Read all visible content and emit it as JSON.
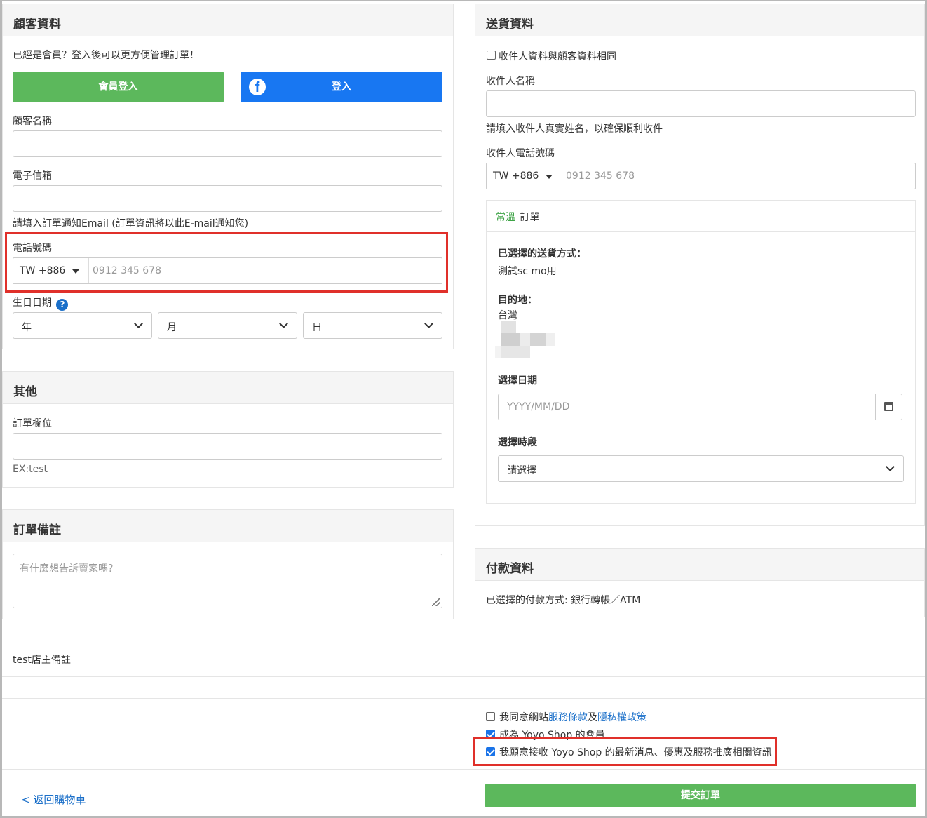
{
  "customer": {
    "title": "顧客資料",
    "member_prompt": "已經是會員？登入後可以更方便管理訂單！",
    "member_login_btn": "會員登入",
    "fb_login_btn": "登入",
    "name_label": "顧客名稱",
    "email_label": "電子信箱",
    "email_help": "請填入訂單通知Email (訂單資訊將以此E-mail通知您)",
    "phone_label": "電話號碼",
    "phone_cc": "TW  +886",
    "phone_placeholder": "0912 345 678",
    "birthday_label": "生日日期",
    "year": "年",
    "month": "月",
    "day": "日"
  },
  "other": {
    "title": "其他",
    "field_label": "訂單欄位",
    "field_help": "EX:test"
  },
  "notes": {
    "title": "訂單備註",
    "placeholder": "有什麼想告訴賣家嗎？"
  },
  "shipping": {
    "title": "送貨資料",
    "same_as_customer": "收件人資料與顧客資料相同",
    "recipient_name_label": "收件人名稱",
    "recipient_name_help": "請填入收件人真實姓名，以確保順利收件",
    "recipient_phone_label": "收件人電話號碼",
    "phone_cc": "TW  +886",
    "phone_placeholder": "0912 345 678",
    "order_temp": "常溫",
    "order_word": "訂單",
    "method_label": "已選擇的送貨方式：",
    "method_value": "測試sc mo用",
    "dest_label": "目的地：",
    "dest_value": "台灣",
    "date_label": "選擇日期",
    "date_placeholder": "YYYY/MM/DD",
    "time_label": "選擇時段",
    "time_value": "請選擇"
  },
  "payment": {
    "title": "付款資料",
    "method": "已選擇的付款方式: 銀行轉帳／ATM"
  },
  "store_note": "test店主備註",
  "agree": {
    "prefix": "我同意網站",
    "terms": "服務條款",
    "and": "及",
    "privacy": "隱私權政策",
    "member": "成為 Yoyo Shop 的會員",
    "newsletter": "我願意接收 Yoyo Shop 的最新消息、優惠及服務推廣相關資訊",
    "member_checked": true,
    "newsletter_checked": true,
    "terms_checked": false
  },
  "back_link": "< 返回購物車",
  "submit_btn": "提交訂單",
  "colors": {
    "green": "#5cb85c",
    "facebook": "#1877f2",
    "highlight": "#e0302a",
    "link": "#1a6fc9",
    "temp_green": "#3fa447"
  }
}
